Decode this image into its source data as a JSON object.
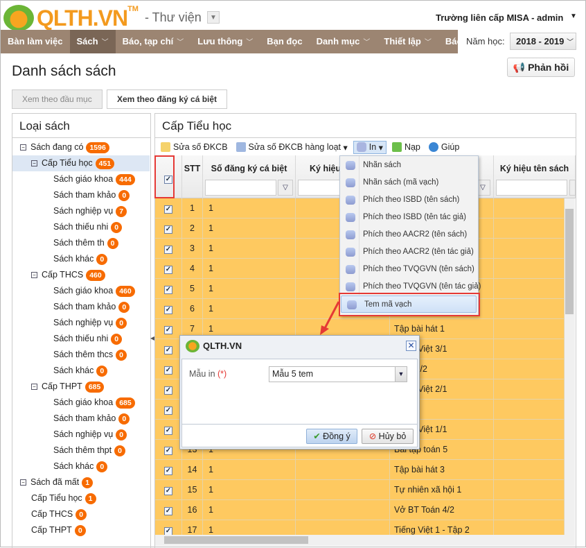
{
  "header": {
    "brand": "QLTH.VN",
    "trademark": "TM",
    "module": "- Thư viện",
    "user": "Trường liên cấp MISA - admin",
    "help": "?"
  },
  "nav": {
    "items": [
      {
        "label": "Bàn làm việc",
        "dd": false
      },
      {
        "label": "Sách",
        "dd": true,
        "active": true
      },
      {
        "label": "Báo, tạp chí",
        "dd": true
      },
      {
        "label": "Lưu thông",
        "dd": true
      },
      {
        "label": "Bạn đọc",
        "dd": false
      },
      {
        "label": "Danh mục",
        "dd": true
      },
      {
        "label": "Thiết lập",
        "dd": true
      },
      {
        "label": "Báo cáo",
        "dd": false
      }
    ],
    "year_label": "Năm học:",
    "year": "2018 - 2019"
  },
  "page": {
    "title": "Danh sách sách",
    "feedback": "Phản hồi",
    "tabs": [
      "Xem theo đầu mục",
      "Xem theo đăng ký cá biệt"
    ]
  },
  "tree": {
    "title": "Loại sách",
    "items": [
      {
        "label": "Sách đang có",
        "count": "1596",
        "level": 0
      },
      {
        "label": "Cấp Tiểu học",
        "count": "451",
        "level": 1,
        "selected": true
      },
      {
        "label": "Sách giáo khoa",
        "count": "444",
        "level": 2
      },
      {
        "label": "Sách tham khảo",
        "count": "0",
        "level": 2
      },
      {
        "label": "Sách nghiệp vụ",
        "count": "7",
        "level": 2
      },
      {
        "label": "Sách thiếu nhi",
        "count": "0",
        "level": 2
      },
      {
        "label": "Sách thêm th",
        "count": "0",
        "level": 2
      },
      {
        "label": "Sách khác",
        "count": "0",
        "level": 2
      },
      {
        "label": "Cấp THCS",
        "count": "460",
        "level": 1
      },
      {
        "label": "Sách giáo khoa",
        "count": "460",
        "level": 2
      },
      {
        "label": "Sách tham khảo",
        "count": "0",
        "level": 2
      },
      {
        "label": "Sách nghiệp vụ",
        "count": "0",
        "level": 2
      },
      {
        "label": "Sách thiếu nhi",
        "count": "0",
        "level": 2
      },
      {
        "label": "Sách thêm thcs",
        "count": "0",
        "level": 2
      },
      {
        "label": "Sách khác",
        "count": "0",
        "level": 2
      },
      {
        "label": "Cấp THPT",
        "count": "685",
        "level": 1
      },
      {
        "label": "Sách giáo khoa",
        "count": "685",
        "level": 2
      },
      {
        "label": "Sách tham khảo",
        "count": "0",
        "level": 2
      },
      {
        "label": "Sách nghiệp vụ",
        "count": "0",
        "level": 2
      },
      {
        "label": "Sách thêm thpt",
        "count": "0",
        "level": 2
      },
      {
        "label": "Sách khác",
        "count": "0",
        "level": 2
      },
      {
        "label": "Sách đã mất",
        "count": "1",
        "level": 0
      },
      {
        "label": "Cấp Tiểu học",
        "count": "1",
        "level": 1
      },
      {
        "label": "Cấp THCS",
        "count": "0",
        "level": 1
      },
      {
        "label": "Cấp THPT",
        "count": "0",
        "level": 1
      }
    ]
  },
  "grid": {
    "title": "Cấp Tiểu học",
    "toolbar": {
      "edit": "Sửa số ĐKCB",
      "edit_bulk": "Sửa số ĐKCB hàng loạt",
      "print": "In",
      "reload": "Nạp",
      "help": "Giúp"
    },
    "columns": {
      "stt": "STT",
      "reg": "Số đăng ký cá biệt",
      "code": "Ký hiệu",
      "title_code": "Ký hiệu tên sách"
    },
    "rows": [
      {
        "stt": "1",
        "reg": "1",
        "name": ""
      },
      {
        "stt": "2",
        "reg": "1",
        "name": ""
      },
      {
        "stt": "3",
        "reg": "1",
        "name": ""
      },
      {
        "stt": "4",
        "reg": "1",
        "name": ""
      },
      {
        "stt": "5",
        "reg": "1",
        "name": ""
      },
      {
        "stt": "6",
        "reg": "1",
        "name": ""
      },
      {
        "stt": "7",
        "reg": "1",
        "name": "Tập bài hát 1"
      },
      {
        "stt": "8",
        "reg": "1",
        "name": "Tiếng Việt 3/1"
      },
      {
        "stt": "9",
        "reg": "1",
        "name": "Toán 5/2"
      },
      {
        "stt": "10",
        "reg": "1",
        "name": "Tiếng Việt 2/1"
      },
      {
        "stt": "11",
        "reg": "1",
        "name": "vẽ 4"
      },
      {
        "stt": "12",
        "reg": "1",
        "name": "Tiếng Việt 1/1"
      },
      {
        "stt": "13",
        "reg": "1",
        "name": "Bài tập toán 5"
      },
      {
        "stt": "14",
        "reg": "1",
        "name": "Tập bài hát 3"
      },
      {
        "stt": "15",
        "reg": "1",
        "name": "Tự nhiên xã hội 1"
      },
      {
        "stt": "16",
        "reg": "1",
        "name": "Vở BT Toán 4/2"
      },
      {
        "stt": "17",
        "reg": "1",
        "name": "Tiếng Việt 1 - Tập 2"
      }
    ]
  },
  "print_menu": [
    "Nhãn sách",
    "Nhãn sách (mã vạch)",
    "Phích theo ISBD (tên sách)",
    "Phích theo ISBD (tên tác giả)",
    "Phích theo AACR2 (tên sách)",
    "Phích theo AACR2 (tên tác giả)",
    "Phích theo TVQGVN (tên sách)",
    "Phích theo TVQGVN (tên tác giả)",
    "Tem mã vạch"
  ],
  "dialog": {
    "title": "QLTH.VN",
    "label": "Mẫu in",
    "required": "(*)",
    "template": "Mẫu 5 tem",
    "ok": "Đồng ý",
    "cancel": "Hủy bỏ"
  },
  "colors": {
    "accent": "#f76b00",
    "nav": "#9c8572",
    "row": "#fec960",
    "highlight": "#e53935"
  }
}
